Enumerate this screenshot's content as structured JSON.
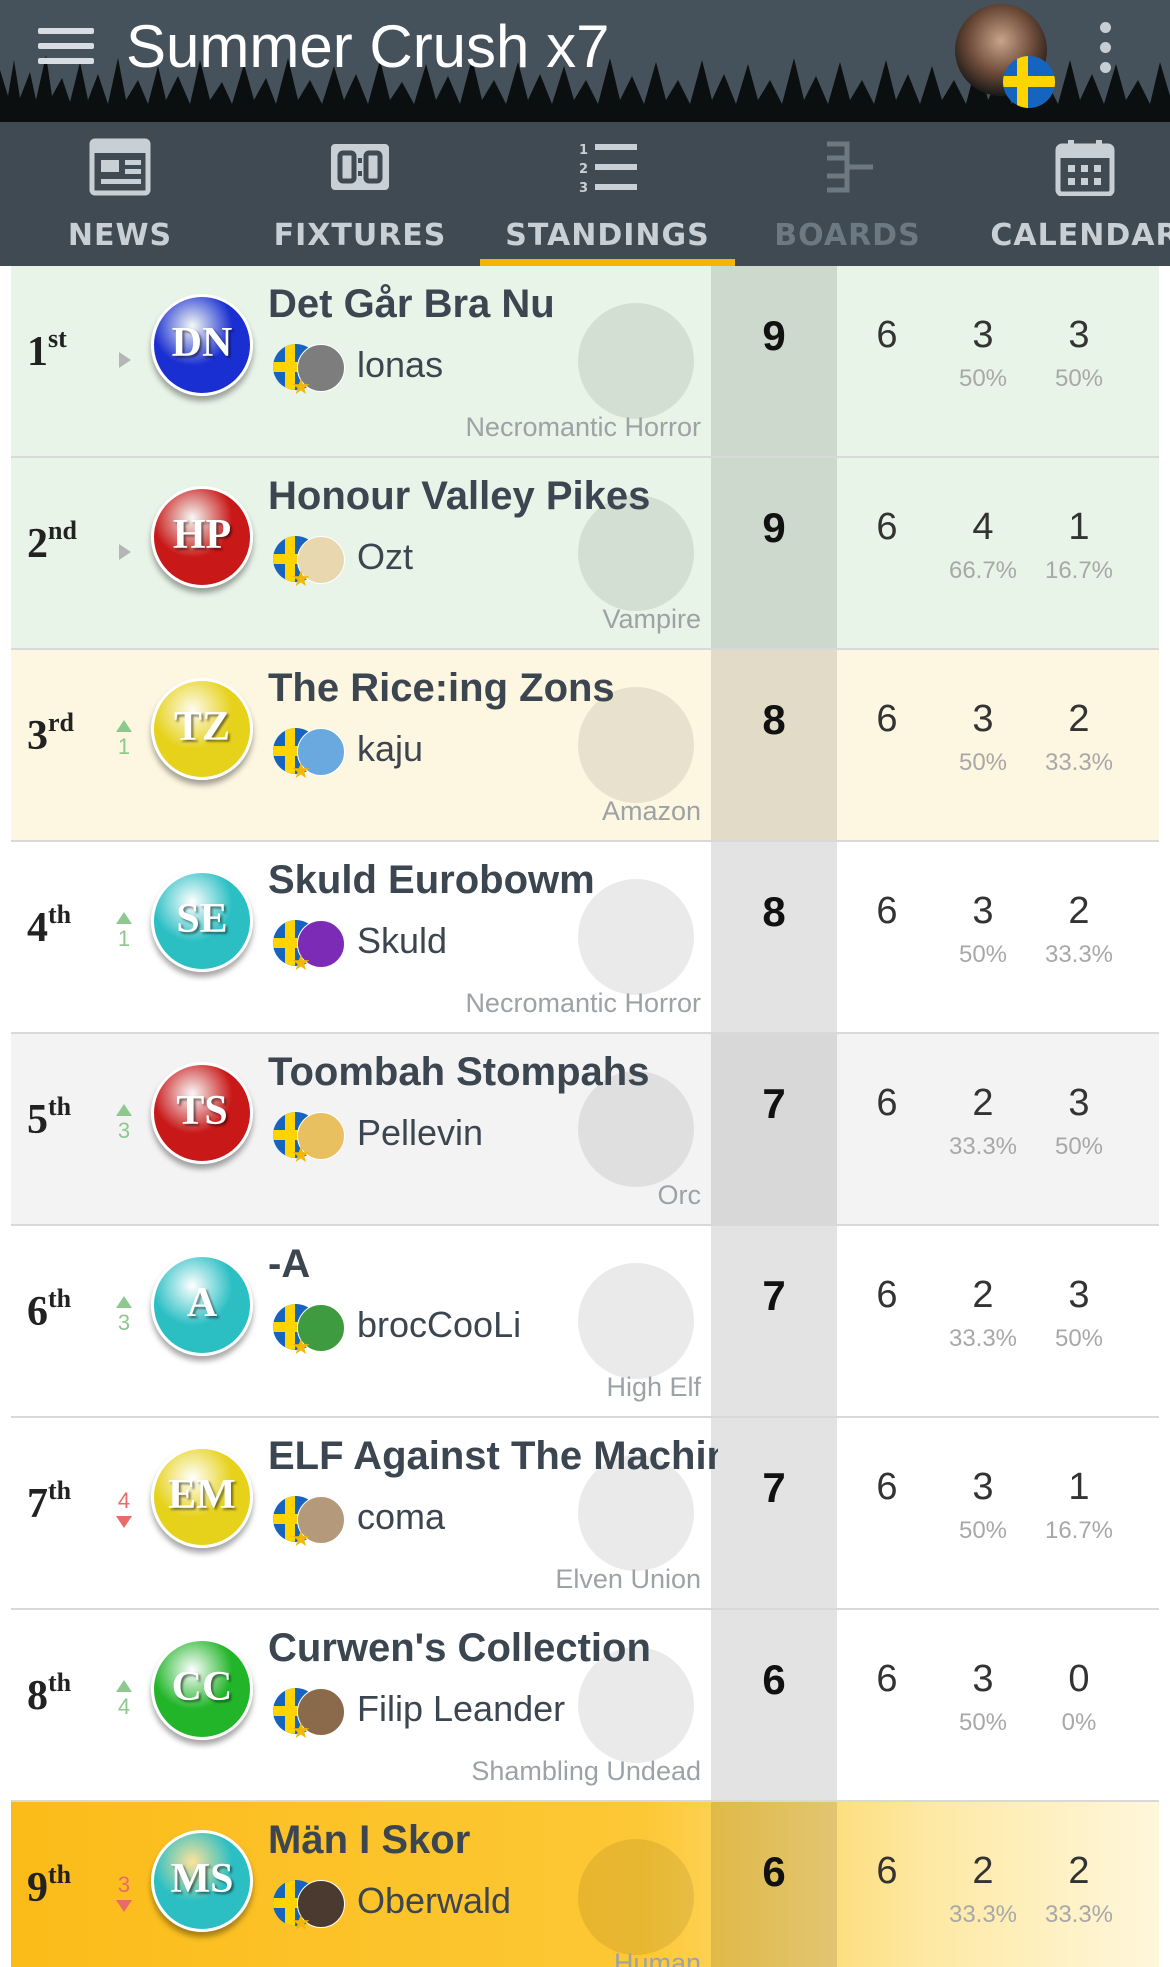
{
  "app": {
    "title": "Summer Crush x7"
  },
  "tabs": [
    {
      "label": "NEWS",
      "icon": "news-icon",
      "state": "normal"
    },
    {
      "label": "FIXTURES",
      "icon": "fixtures-icon",
      "state": "normal"
    },
    {
      "label": "STANDINGS",
      "icon": "standings-icon",
      "state": "active"
    },
    {
      "label": "BOARDS",
      "icon": "boards-icon",
      "state": "disabled"
    },
    {
      "label": "CALENDAR",
      "icon": "calendar-icon",
      "state": "normal"
    }
  ],
  "colors": {
    "topbar": "#46525b",
    "tabbar": "#3f4a53",
    "active_indicator": "#f6b400",
    "trend_up": "#8dc88d",
    "trend_down": "#ea6a6a"
  },
  "standings": [
    {
      "pos": "1",
      "suffix": "st",
      "trend": "none",
      "change": "",
      "initials": "DN",
      "team": "Det Går Bra Nu",
      "coach": "lonas",
      "race": "Necromantic Horror",
      "points": "9",
      "played": "6",
      "w": "3",
      "w_pct": "50%",
      "d": "3",
      "d_pct": "50%",
      "badge_color": "#1a2fd1",
      "bg": "green"
    },
    {
      "pos": "2",
      "suffix": "nd",
      "trend": "none",
      "change": "",
      "initials": "HP",
      "team": "Honour Valley Pikes",
      "coach": "Ozt",
      "race": "Vampire",
      "points": "9",
      "played": "6",
      "w": "4",
      "w_pct": "66.7%",
      "d": "1",
      "d_pct": "16.7%",
      "badge_color": "#c81818",
      "bg": "green"
    },
    {
      "pos": "3",
      "suffix": "rd",
      "trend": "up",
      "change": "1",
      "initials": "TZ",
      "team": "The Rice:ing Zons",
      "coach": "kaju",
      "race": "Amazon",
      "points": "8",
      "played": "6",
      "w": "3",
      "w_pct": "50%",
      "d": "2",
      "d_pct": "33.3%",
      "badge_color": "#e6d21a",
      "bg": "cream"
    },
    {
      "pos": "4",
      "suffix": "th",
      "trend": "up",
      "change": "1",
      "initials": "SE",
      "team": "Skuld Eurobowm",
      "coach": "Skuld",
      "race": "Necromantic Horror",
      "points": "8",
      "played": "6",
      "w": "3",
      "w_pct": "50%",
      "d": "2",
      "d_pct": "33.3%",
      "badge_color": "#2bbfc4",
      "bg": "white"
    },
    {
      "pos": "5",
      "suffix": "th",
      "trend": "up",
      "change": "3",
      "initials": "TS",
      "team": "Toombah Stompahs",
      "coach": "Pellevin",
      "race": "Orc",
      "points": "7",
      "played": "6",
      "w": "2",
      "w_pct": "33.3%",
      "d": "3",
      "d_pct": "50%",
      "badge_color": "#c81818",
      "bg": "gray"
    },
    {
      "pos": "6",
      "suffix": "th",
      "trend": "up",
      "change": "3",
      "initials": "A",
      "team": "-A",
      "coach": "brocCooLi",
      "race": "High Elf",
      "points": "7",
      "played": "6",
      "w": "2",
      "w_pct": "33.3%",
      "d": "3",
      "d_pct": "50%",
      "badge_color": "#2bbfc4",
      "bg": "white"
    },
    {
      "pos": "7",
      "suffix": "th",
      "trend": "down",
      "change": "4",
      "initials": "EM",
      "team": "ELF Against The Machine",
      "coach": "coma",
      "race": "Elven Union",
      "points": "7",
      "played": "6",
      "w": "3",
      "w_pct": "50%",
      "d": "1",
      "d_pct": "16.7%",
      "badge_color": "#e6d21a",
      "bg": "white"
    },
    {
      "pos": "8",
      "suffix": "th",
      "trend": "up",
      "change": "4",
      "initials": "CC",
      "team": "Curwen's Collection",
      "coach": "Filip Leander",
      "race": "Shambling Undead",
      "points": "6",
      "played": "6",
      "w": "3",
      "w_pct": "50%",
      "d": "0",
      "d_pct": "0%",
      "badge_color": "#22b52a",
      "bg": "white"
    },
    {
      "pos": "9",
      "suffix": "th",
      "trend": "down",
      "change": "3",
      "initials": "MS",
      "team": "Män I Skor",
      "coach": "Oberwald",
      "race": "Human",
      "points": "6",
      "played": "6",
      "w": "2",
      "w_pct": "33.3%",
      "d": "2",
      "d_pct": "33.3%",
      "badge_color": "#2bbfc4",
      "bg": "gold"
    }
  ]
}
